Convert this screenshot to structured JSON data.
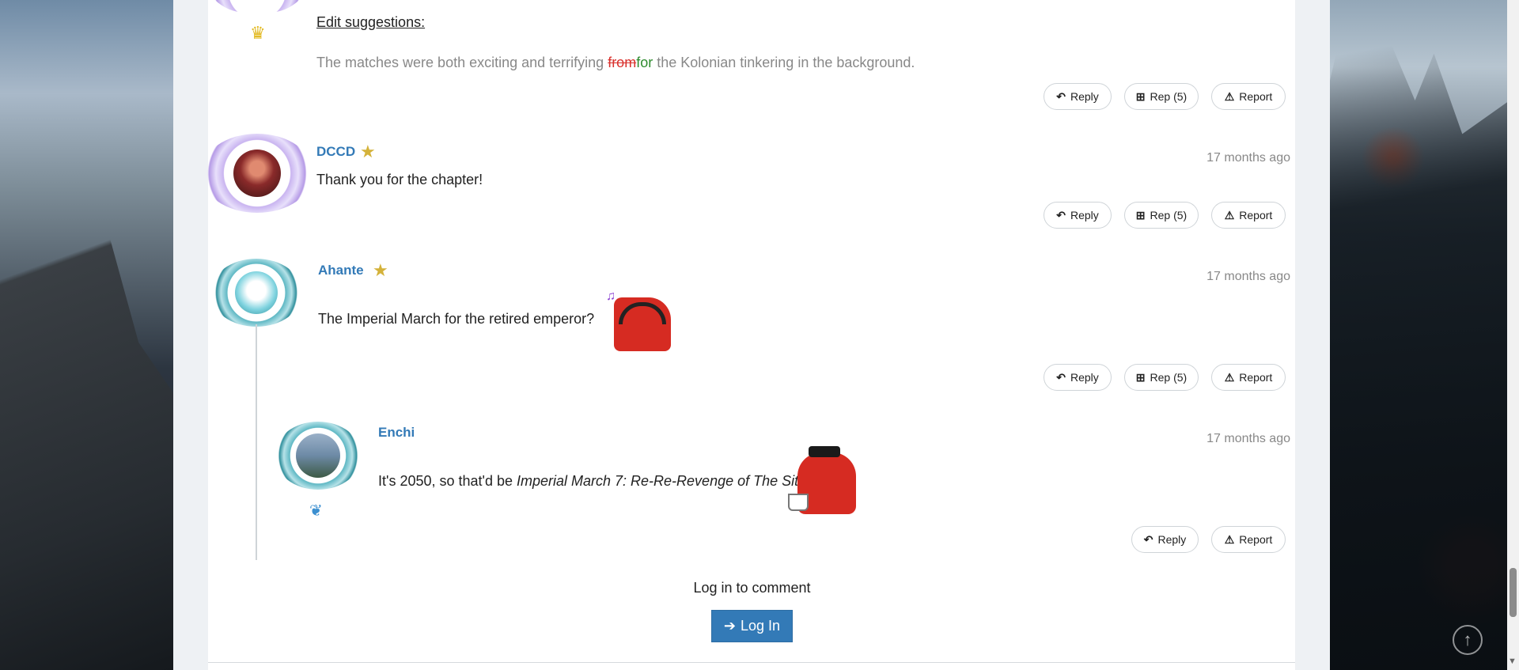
{
  "accent_color": "#337ab7",
  "comment0": {
    "edit_heading": "Edit suggestions:",
    "edit_text_before": "The matches were both exciting and terrifying ",
    "edit_deleted": "from",
    "edit_inserted": "for",
    "edit_text_after": " the Kolonian tinkering in the background.",
    "badge_icon": "crown-icon",
    "actions": {
      "reply": "Reply",
      "rep": "Rep (5)",
      "report": "Report"
    }
  },
  "comment1": {
    "author": "DCCD",
    "time": "17 months ago",
    "text": "Thank you for the chapter!",
    "badge_icon": "star-icon",
    "actions": {
      "reply": "Reply",
      "rep": "Rep (5)",
      "report": "Report"
    }
  },
  "comment2": {
    "author": "Ahante",
    "time": "17 months ago",
    "text": "The Imperial March for the retired emperor?",
    "badge_icon": "star-icon",
    "actions": {
      "reply": "Reply",
      "rep": "Rep (5)",
      "report": "Report"
    }
  },
  "comment3": {
    "author": "Enchi",
    "time": "17 months ago",
    "text_plain": "It's 2050, so that'd be ",
    "text_italic": "Imperial March 7: Re-Re-Revenge of The Sith",
    "text_end": ".",
    "badge_icon": "feather-icon",
    "actions": {
      "reply": "Reply",
      "report": "Report"
    }
  },
  "login": {
    "prompt": "Log in to comment",
    "button": "Log In"
  }
}
